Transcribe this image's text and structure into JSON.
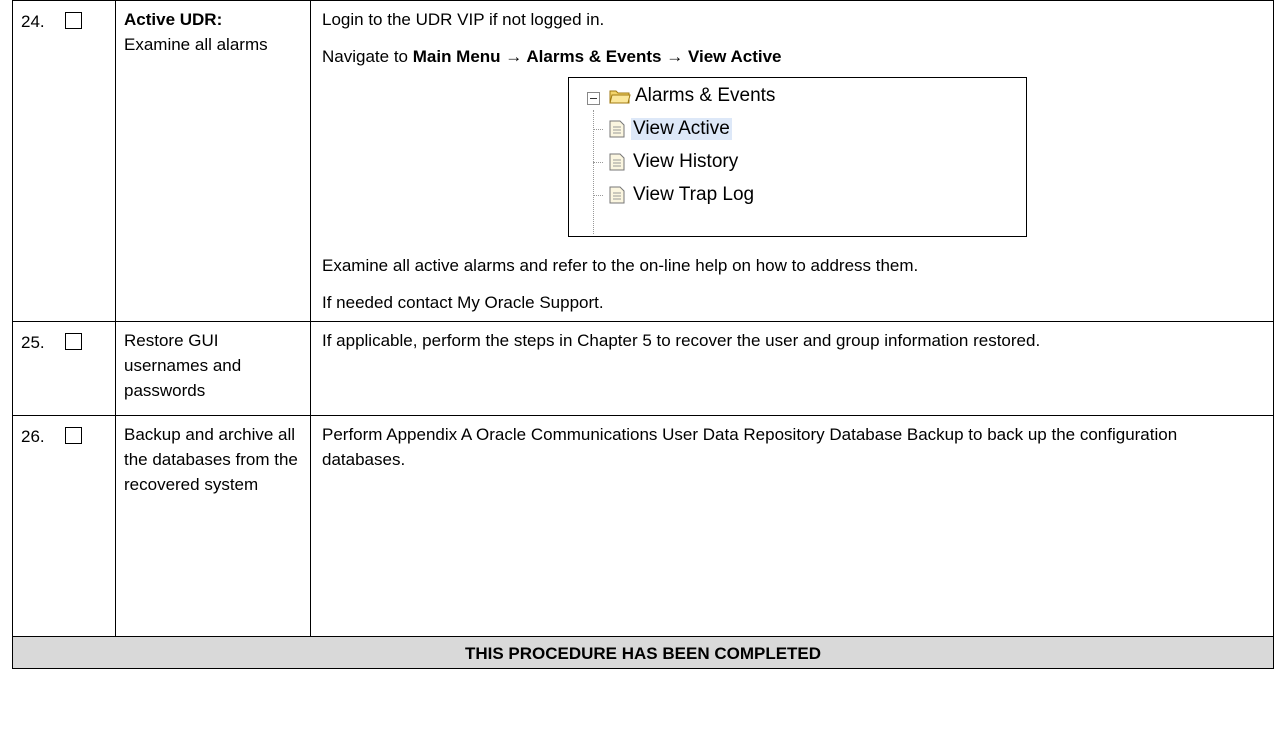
{
  "steps": [
    {
      "number": "24.",
      "title_bold": "Active UDR:",
      "title_rest": "Examine all alarms",
      "line1": "Login to the UDR VIP if not logged in.",
      "nav_prefix": "Navigate to ",
      "nav_path": "Main Menu → Alarms & Events → View Active",
      "tree": {
        "folder": "Alarms & Events",
        "items": [
          "View Active",
          "View History",
          "View Trap Log"
        ],
        "selected": "View Active"
      },
      "line2": "Examine all active alarms and refer to the on-line help on how to address them.",
      "line3": "If needed contact My Oracle Support."
    },
    {
      "number": "25.",
      "title": "Restore GUI usernames and passwords",
      "body": "If applicable, perform the steps in Chapter 5 to recover the user and group information restored."
    },
    {
      "number": "26.",
      "title": "Backup and archive all the databases from the recovered system",
      "body": "Perform Appendix A Oracle Communications User Data Repository Database Backup to back up the configuration databases."
    }
  ],
  "footer": "THIS PROCEDURE HAS BEEN COMPLETED"
}
